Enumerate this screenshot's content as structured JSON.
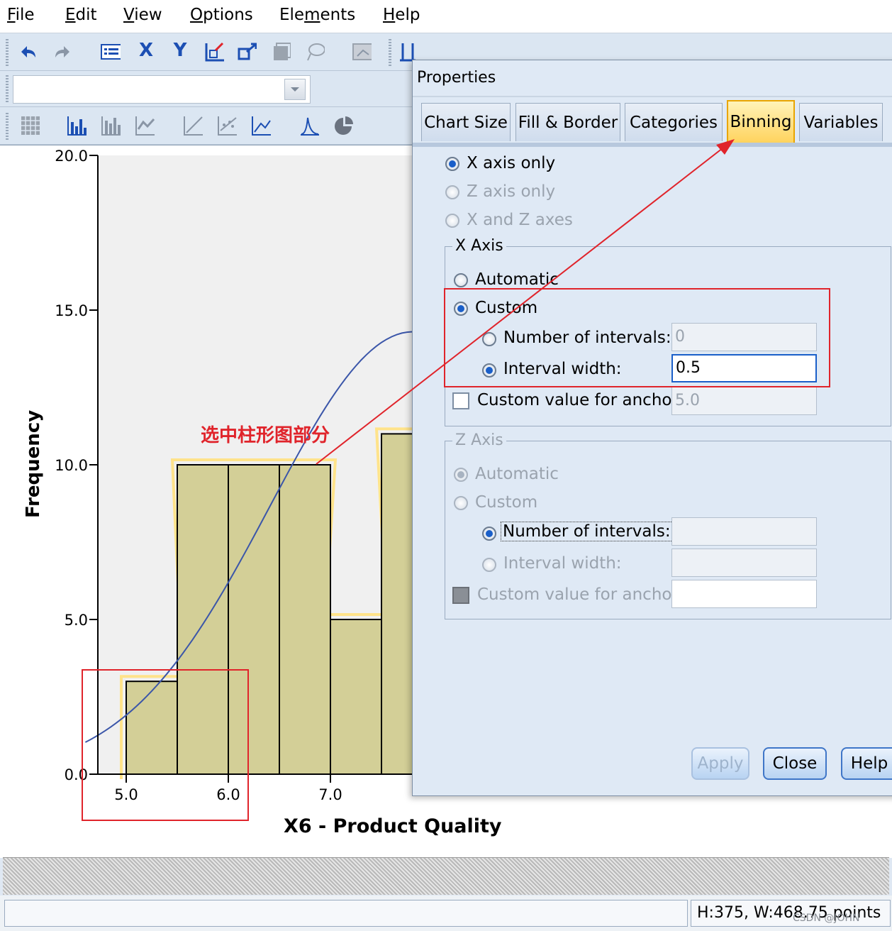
{
  "menu": [
    "File",
    "Edit",
    "View",
    "Options",
    "Elements",
    "Help"
  ],
  "menu_accel": [
    "F",
    "E",
    "V",
    "O",
    "m",
    "H"
  ],
  "chart_data": {
    "type": "bar",
    "xlabel": "X6 - Product Quality",
    "ylabel": "Frequency",
    "ytick_labels": [
      "0.0",
      "5.0",
      "10.0",
      "15.0",
      "20.0"
    ],
    "xtick_labels": [
      "5.0",
      "6.0",
      "7.0"
    ],
    "ylim": [
      0,
      20
    ],
    "bins": [
      {
        "x0": 5.0,
        "x1": 5.5,
        "value": 3
      },
      {
        "x0": 5.5,
        "x1": 6.0,
        "value": 10
      },
      {
        "x0": 6.0,
        "x1": 6.5,
        "value": 10
      },
      {
        "x0": 6.5,
        "x1": 7.0,
        "value": 10
      },
      {
        "x0": 7.0,
        "x1": 7.5,
        "value": 5
      },
      {
        "x0": 7.5,
        "x1": 8.0,
        "value": 11
      }
    ],
    "bar_color": "#d3cf97",
    "normal_curve": true,
    "annotation": "选中柱形图部分"
  },
  "dialog": {
    "title": "Properties",
    "tabs": [
      "Chart Size",
      "Fill & Border",
      "Categories",
      "Binning",
      "Variables"
    ],
    "active_tab": "Binning",
    "axes_options": [
      "X axis only",
      "Z axis only",
      "X and Z axes"
    ],
    "x_axis": {
      "title": "X Axis",
      "automatic": "Automatic",
      "custom": "Custom",
      "num_intervals_label": "Number of intervals:",
      "num_intervals_value": "0",
      "interval_width_label": "Interval width:",
      "interval_width_value": "0.5",
      "anchor_label": "Custom value for anchor:",
      "anchor_value": "5.0"
    },
    "z_axis": {
      "title": "Z Axis",
      "automatic": "Automatic",
      "custom": "Custom",
      "num_intervals_label": "Number of intervals:",
      "interval_width_label": "Interval width:",
      "anchor_label": "Custom value for anchor:"
    },
    "buttons": {
      "apply": "Apply",
      "close": "Close",
      "help": "Help"
    }
  },
  "status": "H:375, W:468.75 points",
  "watermark": "CSDN @JOHN",
  "highlight_color": "#e0242b"
}
